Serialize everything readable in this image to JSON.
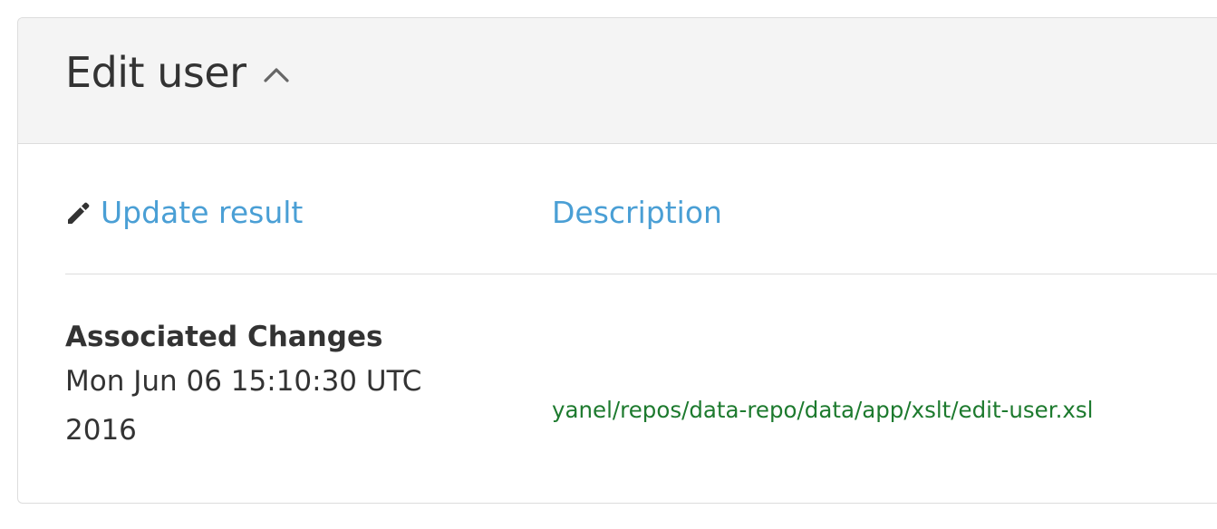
{
  "panel": {
    "title": "Edit user",
    "collapse_icon": "chevron-up-icon"
  },
  "links": {
    "update_result_icon": "pencil-icon",
    "update_result_label": "Update result",
    "description_label": "Description"
  },
  "associated_changes": {
    "heading": "Associated Changes",
    "date": "Mon Jun 06 15:10:30 UTC 2016",
    "file_path": "yanel/repos/data-repo/data/app/xslt/edit-user.xsl"
  },
  "colors": {
    "link": "#4a9fd5",
    "file_path": "#1d7a2e",
    "heading_bg": "#f4f4f4",
    "text": "#333333"
  }
}
